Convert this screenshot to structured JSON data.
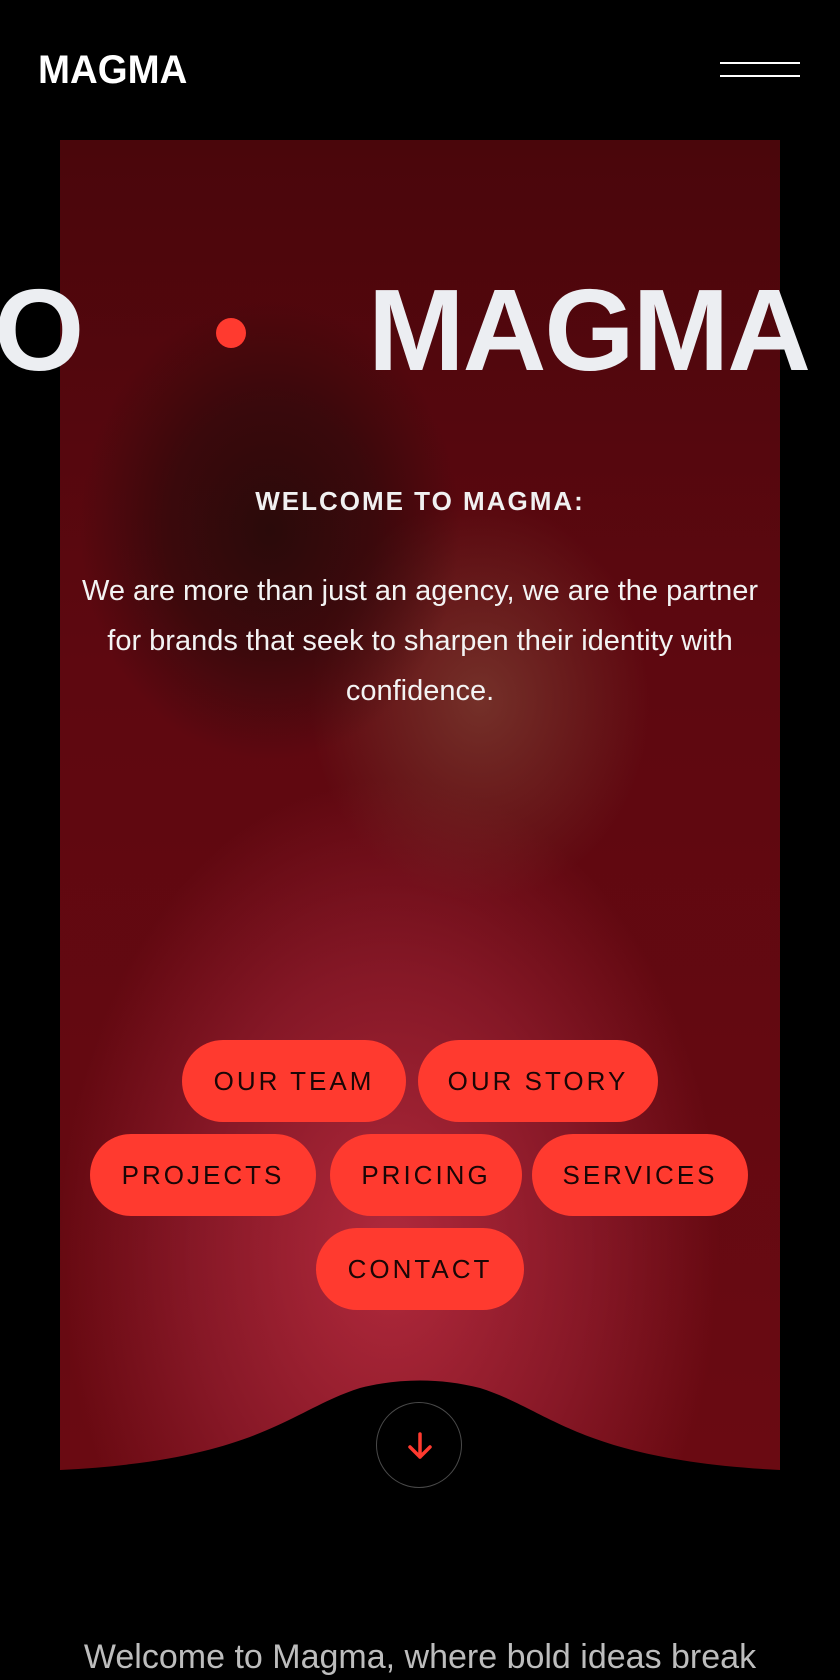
{
  "header": {
    "logo": "MAGMA",
    "menu_icon": "hamburger-menu-icon"
  },
  "hero": {
    "marquee_left": "O",
    "marquee_main": "MAGMA",
    "welcome_heading": "WELCOME TO MAGMA:",
    "intro_text": "We are more than just an agency, we are the partner for brands that seek to sharpen their identity with confidence."
  },
  "nav_pills": {
    "our_team": "OUR TEAM",
    "our_story": "OUR STORY",
    "projects": "PROJECTS",
    "pricing": "PRICING",
    "services": "SERVICES",
    "contact": "CONTACT"
  },
  "scroll_button": {
    "icon": "arrow-down-icon"
  },
  "bottom": {
    "text": "Welcome to Magma, where bold ideas break"
  },
  "colors": {
    "accent": "#ff3a2f",
    "background": "#000000",
    "hero_tint": "#5e0810"
  }
}
